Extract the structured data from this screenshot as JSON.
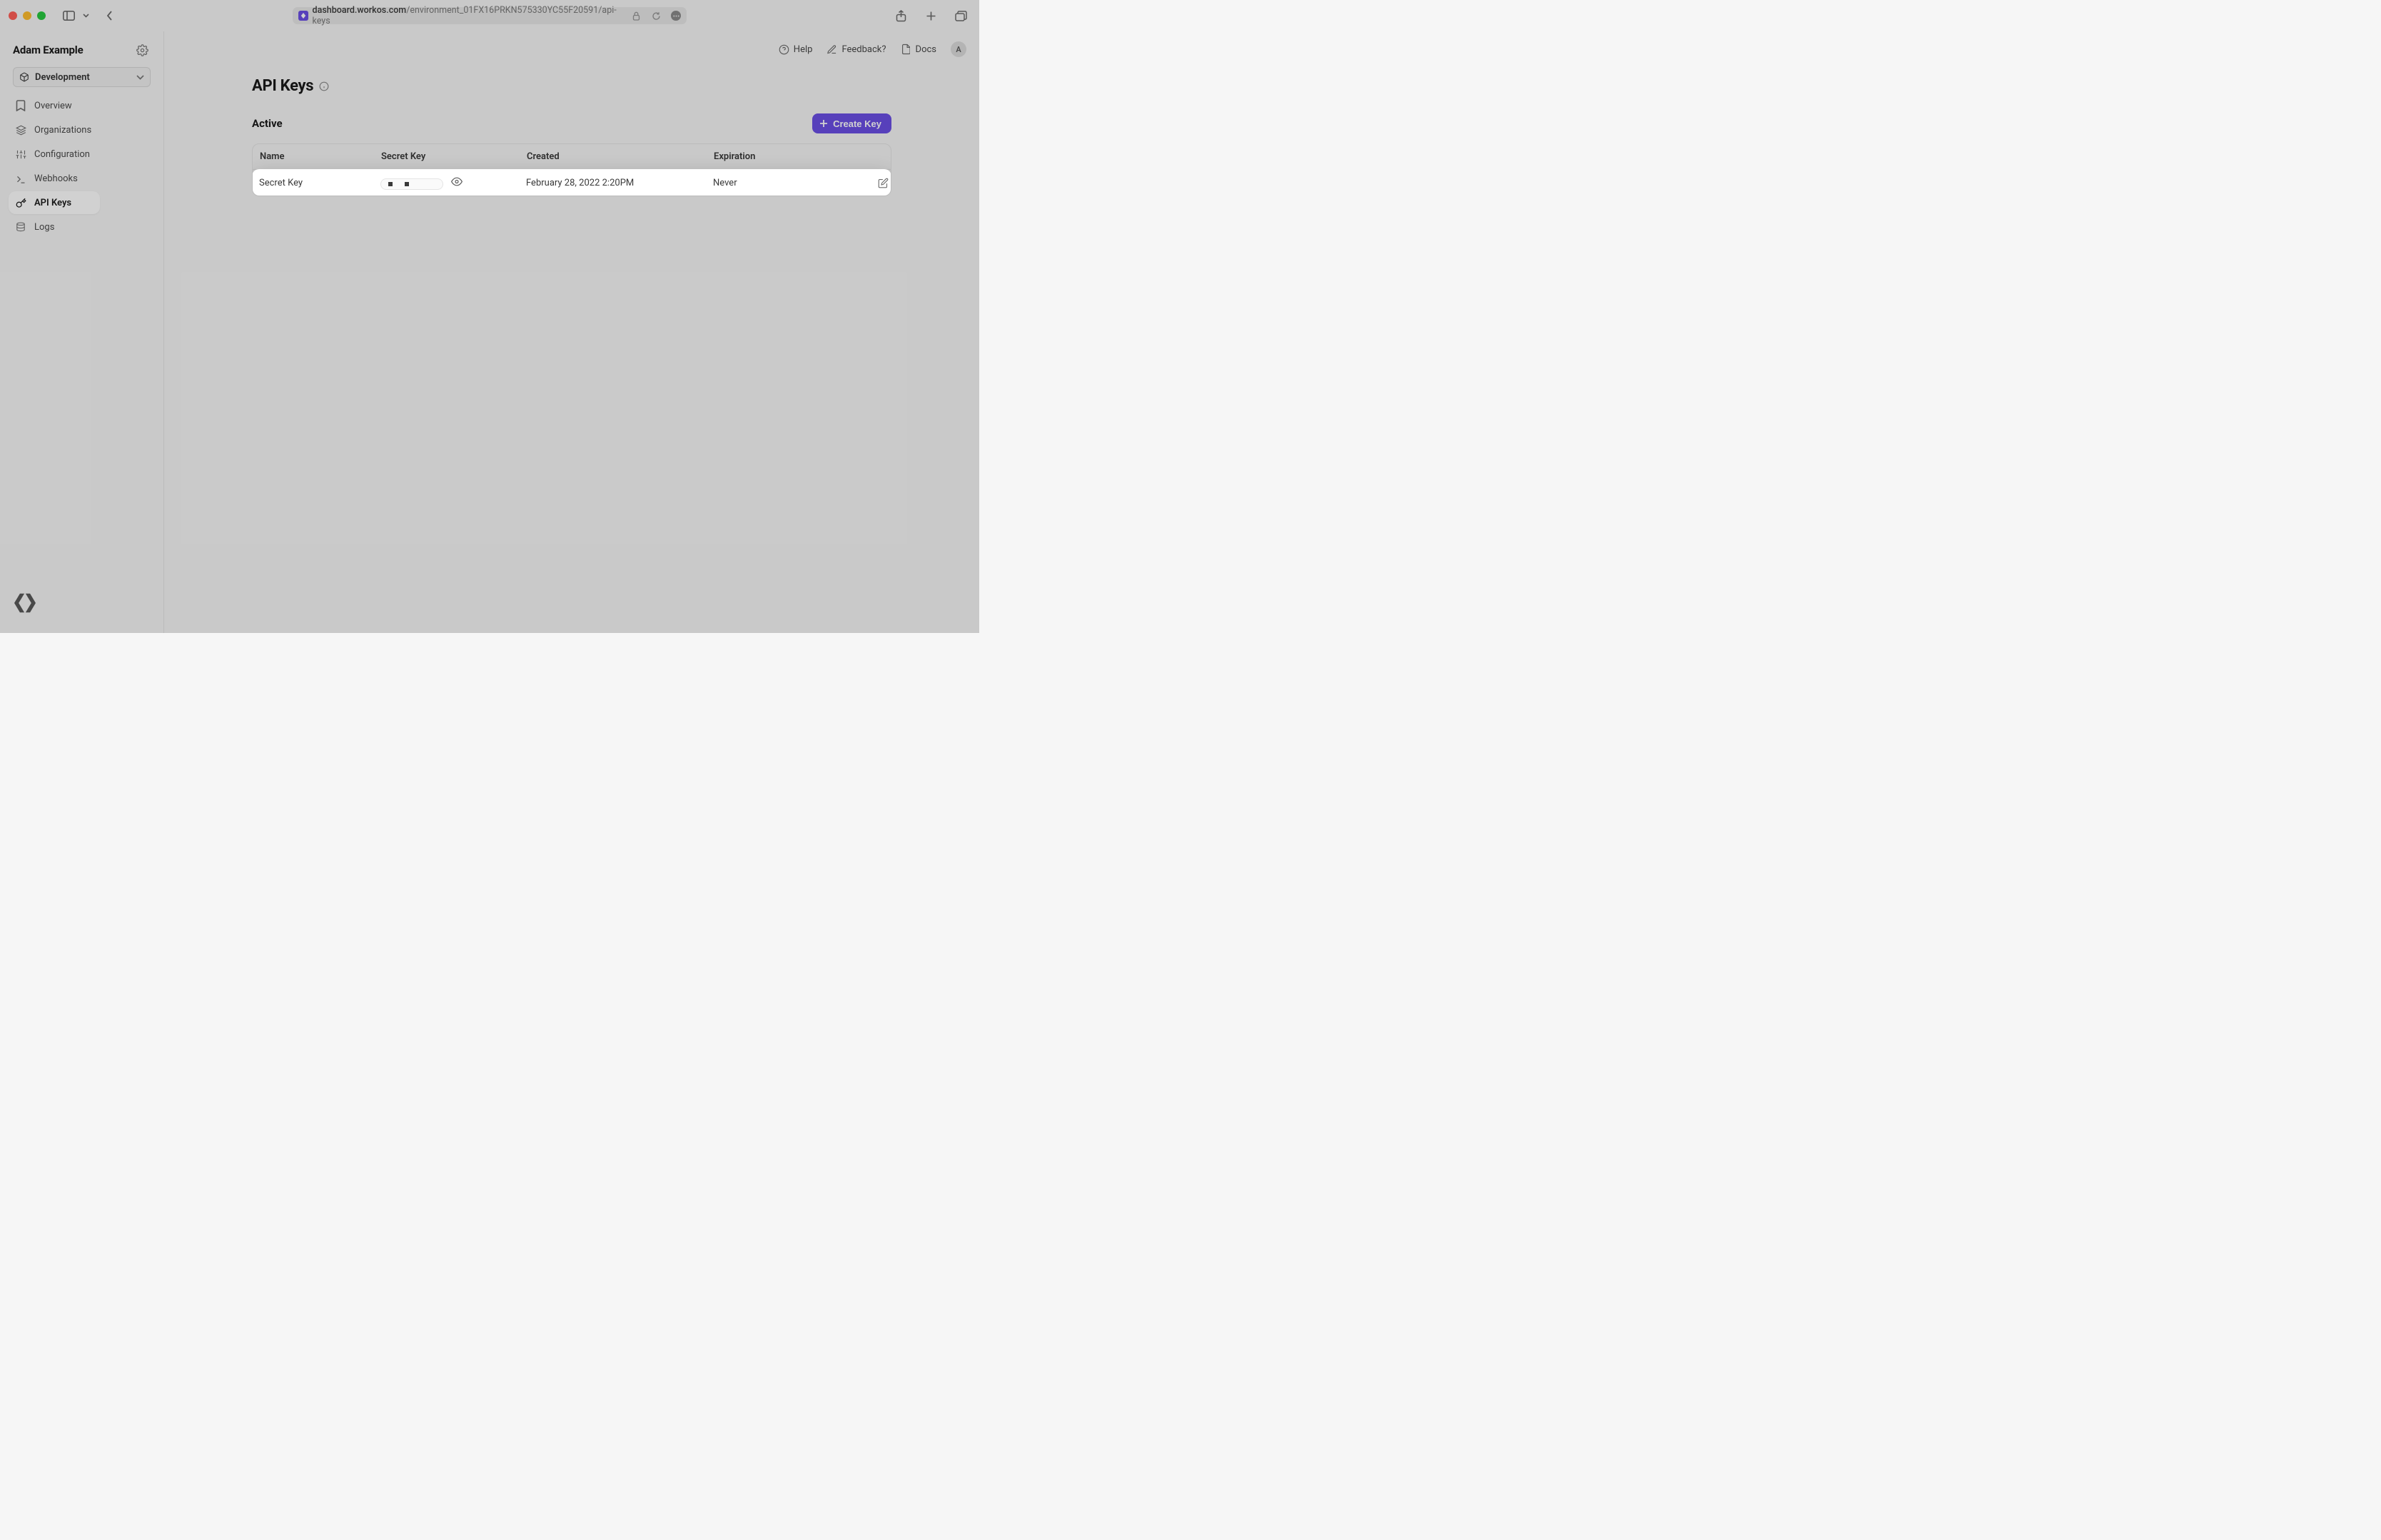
{
  "chrome": {
    "url_host": "dashboard.workos.com",
    "url_path": "/environment_01FX16PRKN575330YC55F20591/api-keys"
  },
  "account": {
    "name": "Adam Example",
    "avatar_initial": "A"
  },
  "env_selector": {
    "label": "Development"
  },
  "sidebar": {
    "items": [
      {
        "label": "Overview"
      },
      {
        "label": "Organizations"
      },
      {
        "label": "Configuration"
      },
      {
        "label": "Webhooks"
      },
      {
        "label": "API Keys"
      },
      {
        "label": "Logs"
      }
    ]
  },
  "topbar": {
    "help": "Help",
    "feedback": "Feedback?",
    "docs": "Docs"
  },
  "page": {
    "title": "API Keys",
    "section": "Active",
    "create_button": "Create Key",
    "columns": {
      "name": "Name",
      "secret": "Secret Key",
      "created": "Created",
      "expiration": "Expiration"
    },
    "rows": [
      {
        "name": "Secret Key",
        "created": "February 28, 2022 2:20PM",
        "expiration": "Never"
      }
    ]
  },
  "colors": {
    "accent": "#6b4fe4"
  }
}
